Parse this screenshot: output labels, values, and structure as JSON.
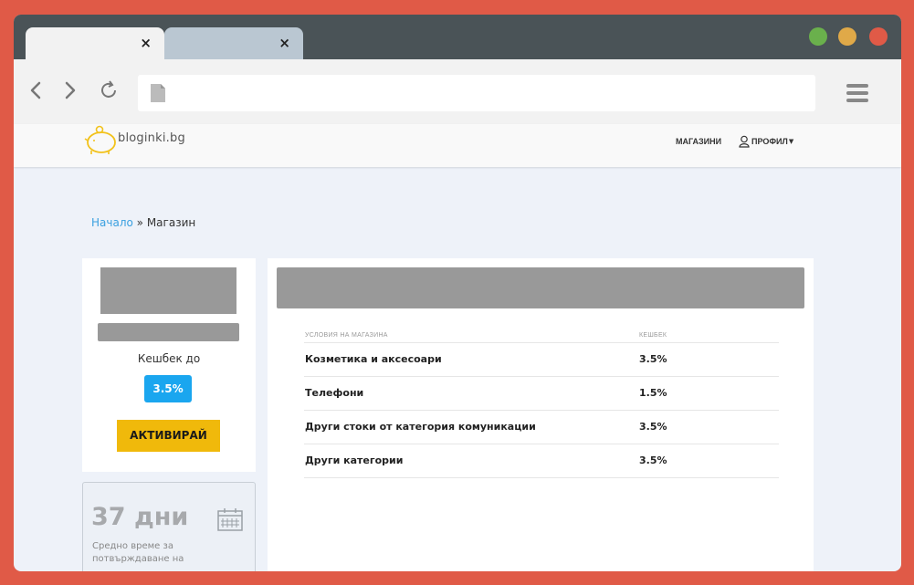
{
  "browser": {
    "tabs": [
      {
        "close": "×"
      },
      {
        "close": "×"
      }
    ],
    "window_controls": {
      "colors": [
        "#6ab04c",
        "#e0a948",
        "#e05a47"
      ]
    },
    "nav_icons": [
      "back-icon",
      "forward-icon",
      "reload-icon",
      "menu-icon"
    ]
  },
  "site": {
    "logo_text": "bloginki.bg",
    "nav": {
      "shops": "МАГАЗИНИ",
      "profile": "ПРОФИЛ"
    }
  },
  "breadcrumb": {
    "home": "Начало",
    "separator": " » ",
    "current": "Магазин"
  },
  "shop_card": {
    "cashback_label": "Кешбек до",
    "cashback_value": "3.5%",
    "activate_label": "АКТИВИРАЙ"
  },
  "days_card": {
    "value": "37 дни",
    "description": "Средно време за потвърждаване на"
  },
  "terms_table": {
    "headers": [
      "УСЛОВИЯ НА МАГАЗИНА",
      "КЕШБЕК"
    ],
    "rows": [
      [
        "Козметика и аксесоари",
        "3.5%"
      ],
      [
        "Телефони",
        "1.5%"
      ],
      [
        "Други стоки от категория комуникации",
        "3.5%"
      ],
      [
        "Други категории",
        "3.5%"
      ]
    ]
  },
  "colors": {
    "accent_blue": "#1aa6ef",
    "activate_yellow": "#f0b90b",
    "link_blue": "#3aa0e0"
  }
}
